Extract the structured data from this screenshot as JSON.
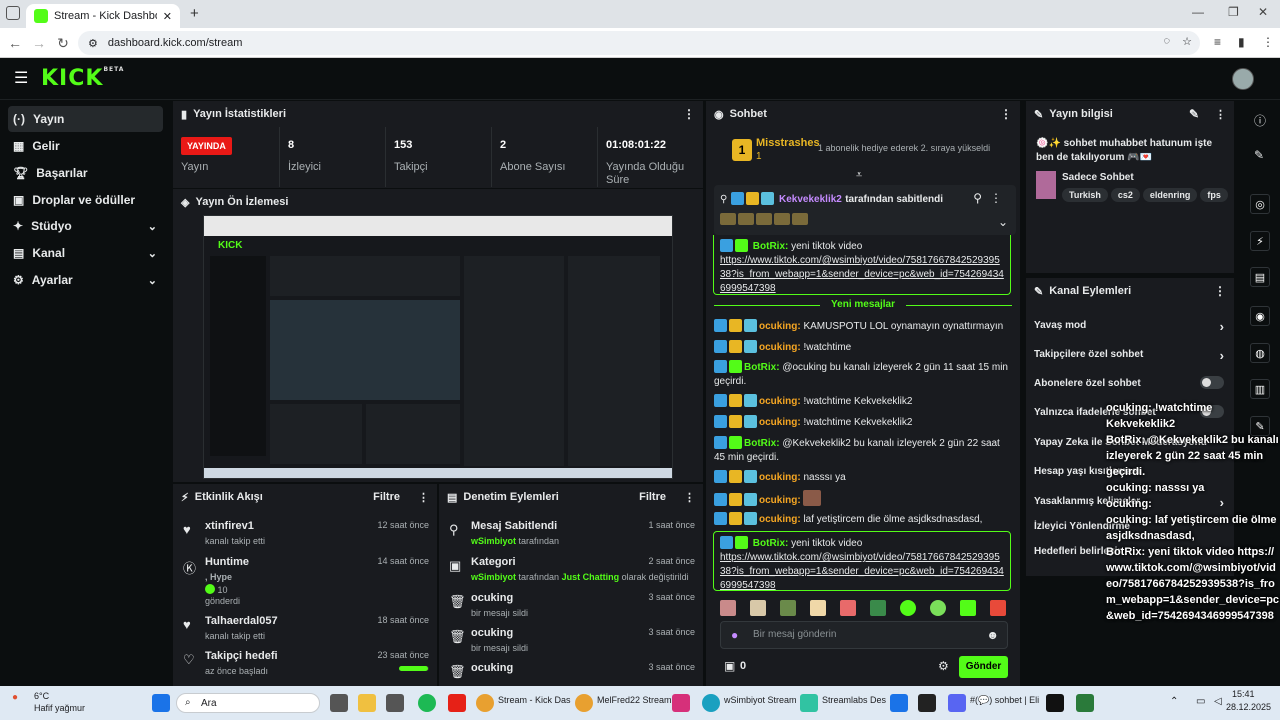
{
  "browser": {
    "tab_title": "Stream - Kick Dashboard",
    "url": "dashboard.kick.com/stream"
  },
  "header": {
    "logo": "KICK",
    "beta": "BETA"
  },
  "sidebar": {
    "items": [
      {
        "label": "Yayın",
        "icon": "broadcast-icon",
        "active": true
      },
      {
        "label": "Gelir",
        "icon": "revenue-icon"
      },
      {
        "label": "Başarılar",
        "icon": "trophy-icon"
      },
      {
        "label": "Droplar ve ödüller",
        "icon": "gift-icon"
      },
      {
        "label": "Stüdyo",
        "icon": "studio-icon",
        "chevron": true
      },
      {
        "label": "Kanal",
        "icon": "channel-icon",
        "chevron": true
      },
      {
        "label": "Ayarlar",
        "icon": "settings-icon",
        "chevron": true
      }
    ]
  },
  "stats": {
    "title": "Yayın İstatistikleri",
    "live_badge": "YAYINDA",
    "live_label": "Yayın",
    "items": [
      {
        "value": "8",
        "label": "İzleyici"
      },
      {
        "value": "153",
        "label": "Takipçi"
      },
      {
        "value": "2",
        "label": "Abone Sayısı"
      },
      {
        "value": "01:08:01:22",
        "label": "Yayında Olduğu Süre"
      }
    ]
  },
  "preview": {
    "title": "Yayın Ön İzlemesi"
  },
  "activity": {
    "title": "Etkinlik Akışı",
    "filter": "Filtre",
    "items": [
      {
        "name": "xtinfirev1",
        "sub": "kanalı takip etti",
        "time": "12 saat önce",
        "icon": "heart-icon"
      },
      {
        "name": "Huntime",
        "sub": ", Hype",
        "sub2": "10",
        "sub3": "gönderdi",
        "time": "14 saat önce",
        "icon": "kick-coin-icon"
      },
      {
        "name": "Talhaerdal057",
        "sub": "kanalı takip etti",
        "time": "18 saat önce",
        "icon": "heart-icon"
      },
      {
        "name": "Takipçi hedefi",
        "sub": "az önce başladı",
        "time": "23 saat önce",
        "icon": "heart-outline-icon",
        "progress": 0.95
      }
    ]
  },
  "moderation": {
    "title": "Denetim Eylemleri",
    "filter": "Filtre",
    "items": [
      {
        "name": "Mesaj Sabitlendi",
        "user": "wSimbiyot",
        "rest": "tarafından",
        "time": "1 saat önce",
        "icon": "pin-icon"
      },
      {
        "name": "Kategori",
        "user": "wSimbiyot",
        "rest": "tarafından",
        "cat": "Just Chatting",
        "rest2": "olarak değiştirildi",
        "time": "2 saat önce",
        "icon": "category-icon"
      },
      {
        "name": "ocuking",
        "sub": "bir mesajı sildi",
        "time": "3 saat önce",
        "icon": "trash-icon"
      },
      {
        "name": "ocuking",
        "sub": "bir mesajı sildi",
        "time": "3 saat önce",
        "icon": "trash-icon"
      },
      {
        "name": "ocuking",
        "sub": "",
        "time": "3 saat önce",
        "icon": "trash-icon"
      }
    ]
  },
  "chat": {
    "title": "Sohbet",
    "gifter": {
      "name": "Misstrashes",
      "count": "1",
      "note": "1 abonelik hediye ederek 2. sıraya yükseldi"
    },
    "pinned": {
      "by": "Kekvekeklik2",
      "by_suffix": "tarafından sabitlendi",
      "bot": "BotRix:",
      "text": "yeni tiktok video",
      "link": "https://www.tiktok.com/@wsimbiyot/video/7581766784252939538?is_from_webapp=1&sender_device=pc&web_id=7542694346999547398"
    },
    "new_messages": "Yeni mesajlar",
    "messages": [
      {
        "user": "ocuking:",
        "text": "KAMUSPOTU LOL oynamayın oynattırmayın"
      },
      {
        "user": "ocuking:",
        "text": "!watchtime"
      },
      {
        "user": "BotRix:",
        "bot": true,
        "text": "@ocuking bu kanalı izleyerek 2 gün 11 saat 15 min geçirdi."
      },
      {
        "user": "ocuking:",
        "text": "!watchtime Kekvekeklik2"
      },
      {
        "user": "ocuking:",
        "text": "!watchtime Kekvekeklik2"
      },
      {
        "user": "BotRix:",
        "bot": true,
        "text": "@Kekvekeklik2 bu kanalı izleyerek 2 gün 22 saat 45 min geçirdi."
      },
      {
        "user": "ocuking:",
        "text": "nasssı ya"
      },
      {
        "user": "ocuking:",
        "text": ""
      },
      {
        "user": "ocuking:",
        "text": "laf yetiştircem die ölme asjdksdnasdasd,"
      }
    ],
    "last": {
      "bot": "BotRix:",
      "text": "yeni tiktok video",
      "link": "https://www.tiktok.com/@wsimbiyot/video/7581766784252939538?is_from_webapp=1&sender_device=pc&web_id=7542694346999547398"
    },
    "input_placeholder": "Bir mesaj gönderin",
    "points": "0",
    "send": "Gönder"
  },
  "info": {
    "title": "Yayın bilgisi",
    "stream_title": "🍥✨ sohbet muhabbet hatunum işte ben de takılıyorum 🎮💌",
    "category": "Sadece Sohbet",
    "tags": [
      "Turkish",
      "cs2",
      "eldenring",
      "fps"
    ]
  },
  "channel_actions": {
    "title": "Kanal Eylemleri",
    "items": [
      {
        "label": "Yavaş mod",
        "type": "chevron"
      },
      {
        "label": "Takipçilere özel sohbet",
        "type": "chevron"
      },
      {
        "label": "Abonelere özel sohbet",
        "type": "toggle"
      },
      {
        "label": "Yalnızca ifadelerle sohbet",
        "type": "toggle"
      },
      {
        "label": "Yapay Zeka ile Sohbet Moderasyonu",
        "type": "chevron"
      },
      {
        "label": "Hesap yaşı kısıtlaması",
        "type": "chevron"
      },
      {
        "label": "Yasaklanmış kelimeler",
        "type": "chevron"
      },
      {
        "label": "İzleyici Yönlendirme",
        "type": "chevron"
      },
      {
        "label": "Hedefleri belirleyin",
        "type": "chevron"
      }
    ]
  },
  "overlay": {
    "lines": [
      "ocuking: !watchtime Kekvekeklik2",
      "BotRix: @Kekvekeklik2 bu kanalı izleyerek 2 gün 22 saat 45 min geçirdi.",
      "ocuking: nasssı ya",
      "ocuking:",
      "ocuking: laf yetiştircem die ölme asjdksdnasdasd,",
      "BotRix: yeni tiktok video https://www.tiktok.com/@wsimbiyot/video/7581766784252939538?is_from_webapp=1&sender_device=pc&web_id=7542694346999547398"
    ]
  },
  "taskbar": {
    "weather_temp": "6°C",
    "weather_desc": "Hafif yağmur",
    "search": "Ara",
    "apps": [
      "Stream - Kick Das",
      "MelFred22 Stream",
      "wSimbiyot Stream",
      "Streamlabs Des",
      "#(💬) sohbet | Eli"
    ],
    "time": "15:41",
    "date": "28.12.2025"
  }
}
